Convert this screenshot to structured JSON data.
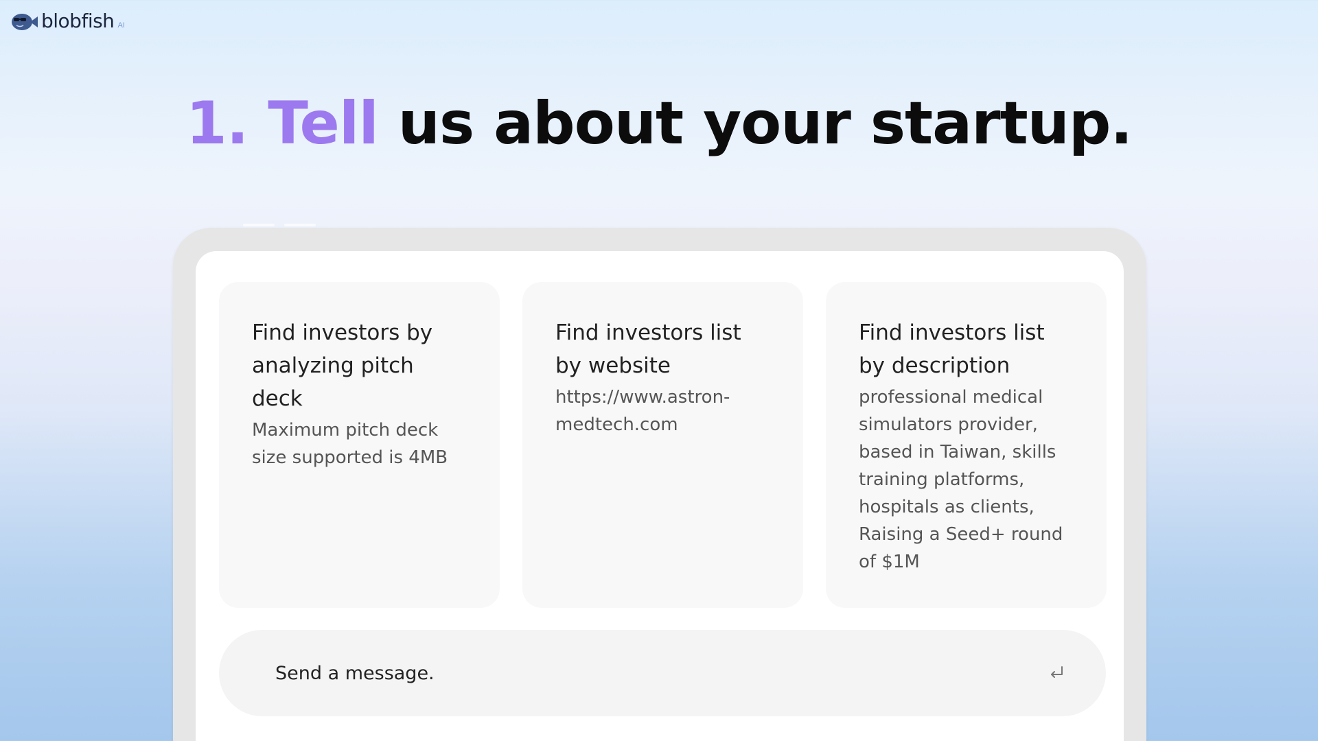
{
  "logo": {
    "name": "blobfish",
    "badge": "AI"
  },
  "headline": {
    "accent": "1. Tell",
    "rest": "us about your startup."
  },
  "cards": [
    {
      "title": "Find investors by analyzing pitch deck",
      "description": "Maximum pitch deck size supported is 4MB"
    },
    {
      "title": "Find investors list by website",
      "description": "https://www.astron-medtech.com"
    },
    {
      "title": "Find investors list by description",
      "description": "professional medical simulators provider, based in Taiwan, skills training platforms, hospitals as clients, Raising a Seed+ round of $1M"
    }
  ],
  "composer": {
    "placeholder": "Send a message.",
    "send_icon": "enter-return-icon"
  },
  "colors": {
    "accent": "#9c79ef",
    "headline": "#0c0c0c",
    "device_frame": "#e6e6e6",
    "card_bg": "#f8f8f9",
    "composer_bg": "#f4f4f4"
  }
}
